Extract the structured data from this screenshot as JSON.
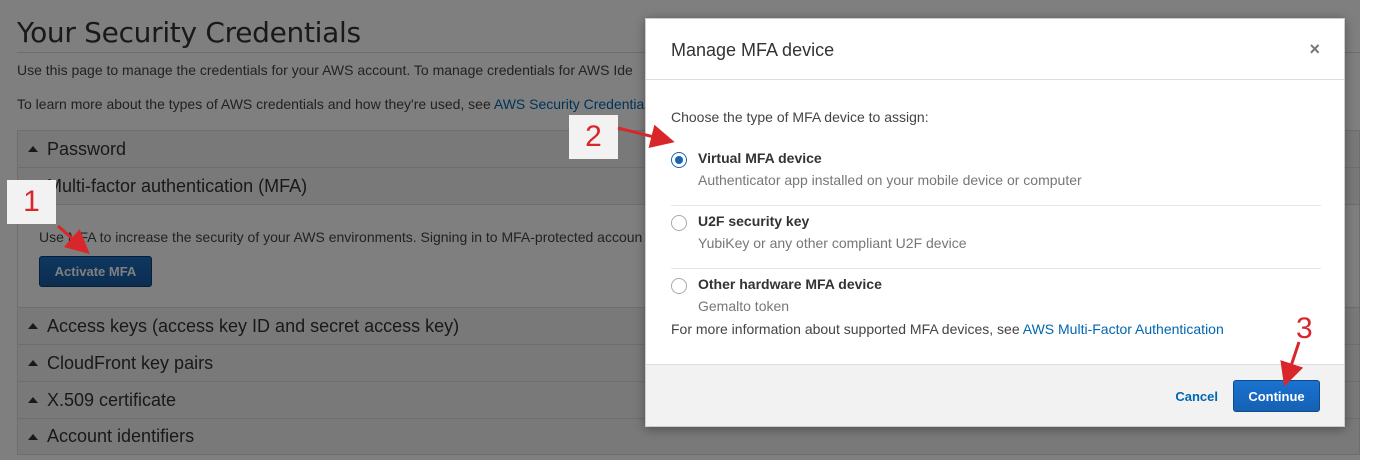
{
  "page": {
    "title": "Your Security Credentials",
    "intro1": "Use this page to manage the credentials for your AWS account. To manage credentials for AWS Ide",
    "intro2_prefix": "To learn more about the types of AWS credentials and how they're used, see ",
    "intro2_link": "AWS Security Credentia"
  },
  "accordion": {
    "password": "Password",
    "mfa": "Multi-factor authentication (MFA)",
    "mfa_text": "Use MFA to increase the security of your AWS environments. Signing in to MFA-protected accoun",
    "activate_button": "Activate MFA",
    "access_keys": "Access keys (access key ID and secret access key)",
    "cloudfront": "CloudFront key pairs",
    "x509": "X.509 certificate",
    "account_ids": "Account identifiers"
  },
  "modal": {
    "title": "Manage MFA device",
    "close": "×",
    "choose": "Choose the type of MFA device to assign:",
    "options": [
      {
        "label": "Virtual MFA device",
        "desc": "Authenticator app installed on your mobile device or computer",
        "checked": true
      },
      {
        "label": "U2F security key",
        "desc": "YubiKey or any other compliant U2F device",
        "checked": false
      },
      {
        "label": "Other hardware MFA device",
        "desc": "Gemalto token",
        "checked": false
      }
    ],
    "more_prefix": "For more information about supported MFA devices, see ",
    "more_link": "AWS Multi-Factor Authentication",
    "cancel": "Cancel",
    "continue": "Continue"
  },
  "steps": {
    "one": "1",
    "two": "2",
    "three": "3"
  },
  "colors": {
    "accent": "#1c64b4",
    "annotation": "#d9262a",
    "link": "#0066b0"
  }
}
